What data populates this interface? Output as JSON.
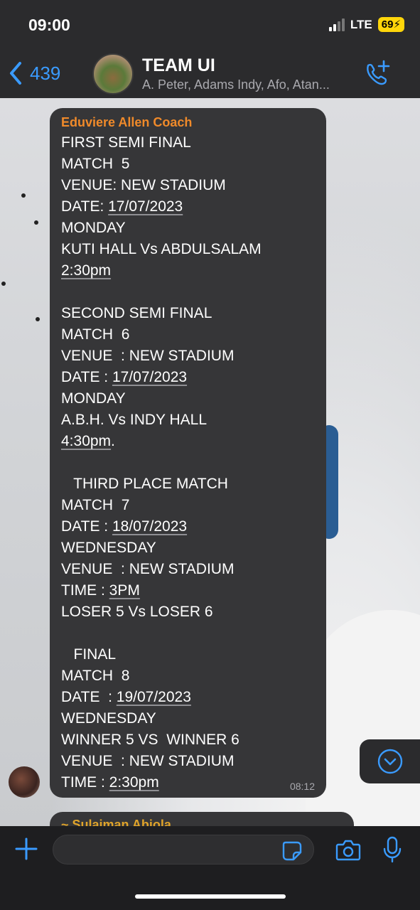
{
  "status": {
    "time": "09:00",
    "network": "LTE",
    "battery": "69"
  },
  "header": {
    "back_count": "439",
    "title": "TEAM UI",
    "subtitle": "A. Peter, Adams Indy, Afo, Atan..."
  },
  "message": {
    "sender": "Eduviere Allen Coach",
    "time": "08:12",
    "lines": [
      {
        "a": "FIRST SEMI FINAL",
        "u": "",
        "b": ""
      },
      {
        "a": "MATCH  5",
        "u": "",
        "b": ""
      },
      {
        "a": "VENUE: NEW STADIUM",
        "u": "",
        "b": ""
      },
      {
        "a": "DATE: ",
        "u": "17/07/2023",
        "b": ""
      },
      {
        "a": "MONDAY",
        "u": "",
        "b": ""
      },
      {
        "a": "KUTI HALL Vs ABDULSALAM",
        "u": "",
        "b": ""
      },
      {
        "a": "",
        "u": "2:30pm",
        "b": ""
      },
      {
        "a": "",
        "u": "",
        "b": ""
      },
      {
        "a": "SECOND SEMI FINAL",
        "u": "",
        "b": ""
      },
      {
        "a": "MATCH  6",
        "u": "",
        "b": ""
      },
      {
        "a": "VENUE  : NEW STADIUM",
        "u": "",
        "b": ""
      },
      {
        "a": "DATE : ",
        "u": "17/07/2023",
        "b": ""
      },
      {
        "a": "MONDAY",
        "u": "",
        "b": ""
      },
      {
        "a": "A.B.H. Vs INDY HALL",
        "u": "",
        "b": ""
      },
      {
        "a": "",
        "u": "4:30pm",
        "b": "."
      },
      {
        "a": "",
        "u": "",
        "b": ""
      },
      {
        "a": "   THIRD PLACE MATCH",
        "u": "",
        "b": ""
      },
      {
        "a": "MATCH  7",
        "u": "",
        "b": ""
      },
      {
        "a": "DATE : ",
        "u": "18/07/2023",
        "b": ""
      },
      {
        "a": "WEDNESDAY",
        "u": "",
        "b": ""
      },
      {
        "a": "VENUE  : NEW STADIUM",
        "u": "",
        "b": ""
      },
      {
        "a": "TIME : ",
        "u": "3PM",
        "b": ""
      },
      {
        "a": "LOSER 5 Vs LOSER 6",
        "u": "",
        "b": ""
      },
      {
        "a": "",
        "u": "",
        "b": ""
      },
      {
        "a": "   FINAL",
        "u": "",
        "b": ""
      },
      {
        "a": "MATCH  8",
        "u": "",
        "b": ""
      },
      {
        "a": "DATE  : ",
        "u": "19/07/2023",
        "b": ""
      },
      {
        "a": "WEDNESDAY",
        "u": "",
        "b": ""
      },
      {
        "a": "WINNER 5 VS  WINNER 6",
        "u": "",
        "b": ""
      },
      {
        "a": "VENUE  : NEW STADIUM",
        "u": "",
        "b": ""
      },
      {
        "a": "TIME : ",
        "u": "2:30pm",
        "b": ""
      }
    ]
  },
  "next_message": {
    "sender_partial": "~ Sulaiman Abiola"
  },
  "composer": {
    "value": ""
  },
  "colors": {
    "accent": "#3a9bff",
    "sender": "#f08a2a",
    "bubble": "#363638",
    "battery": "#ffd60a"
  },
  "icons": {
    "back": "chevron-left-icon",
    "call_add": "phone-plus-icon",
    "plus": "plus-icon",
    "sticker": "sticker-icon",
    "camera": "camera-icon",
    "mic": "microphone-icon",
    "scroll": "chevron-down-circle-icon"
  }
}
